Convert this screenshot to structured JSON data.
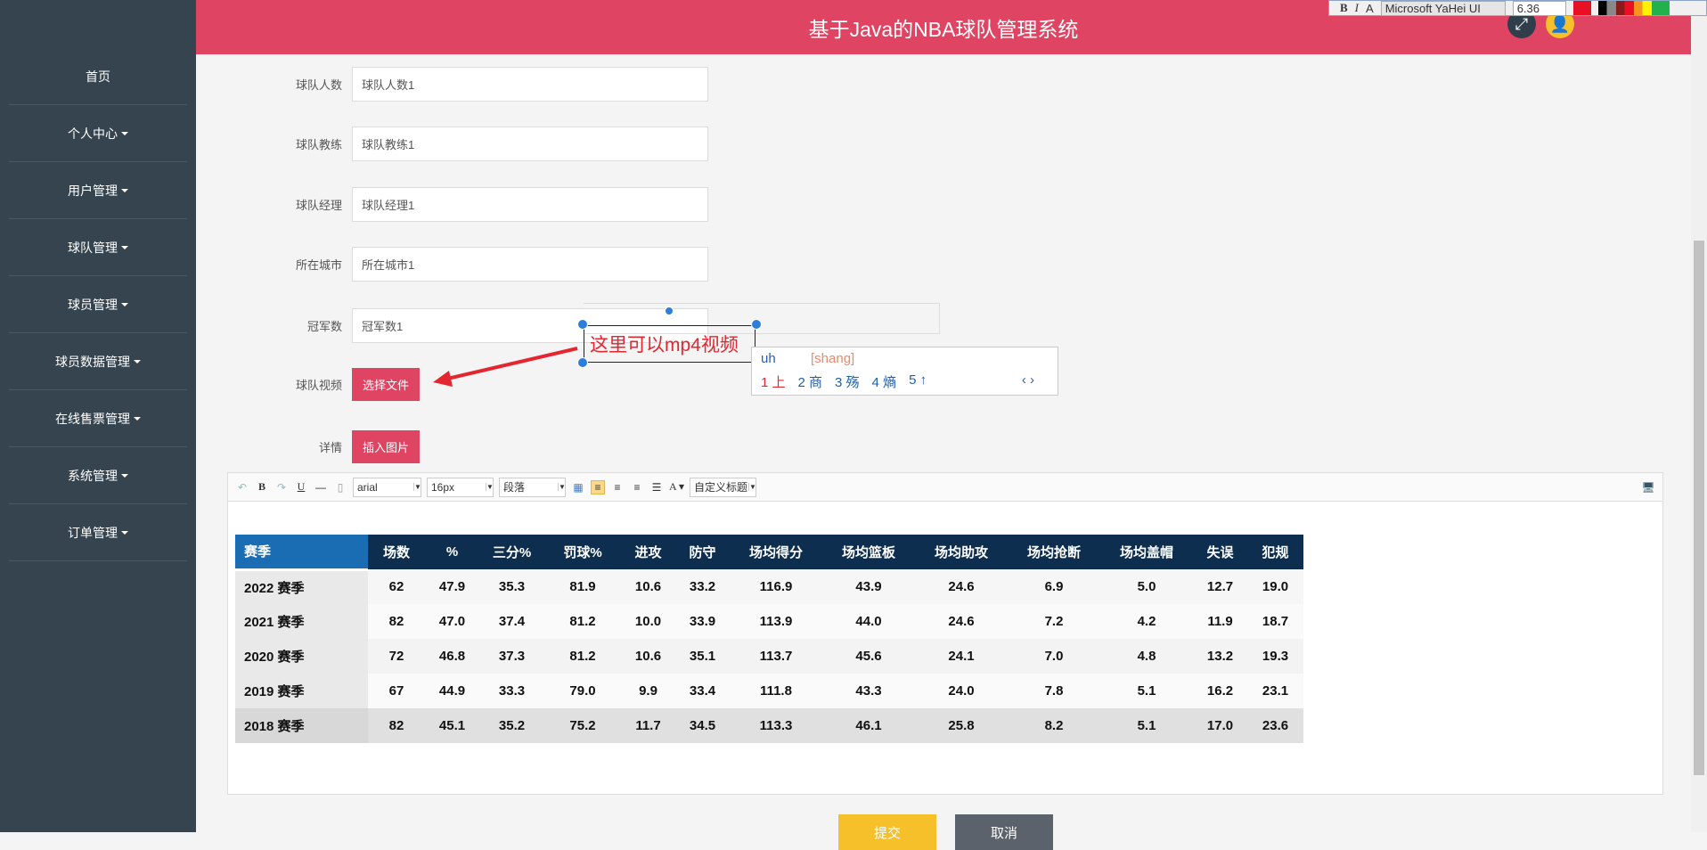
{
  "app": {
    "title": "基于Java的NBA球队管理系统"
  },
  "sidebar": {
    "items": [
      {
        "label": "首页"
      },
      {
        "label": "个人中心"
      },
      {
        "label": "用户管理"
      },
      {
        "label": "球队管理"
      },
      {
        "label": "球员管理"
      },
      {
        "label": "球员数据管理"
      },
      {
        "label": "在线售票管理"
      },
      {
        "label": "系统管理"
      },
      {
        "label": "订单管理"
      }
    ]
  },
  "form": {
    "team_size": {
      "label": "球队人数",
      "value": "球队人数1"
    },
    "coach": {
      "label": "球队教练",
      "value": "球队教练1"
    },
    "manager": {
      "label": "球队经理",
      "value": "球队经理1"
    },
    "city": {
      "label": "所在城市",
      "value": "所在城市1"
    },
    "titles": {
      "label": "冠军数",
      "value": "冠军数1"
    },
    "video": {
      "label": "球队视频",
      "button": "选择文件"
    },
    "detail": {
      "label": "详情",
      "button": "插入图片"
    },
    "submit": "提交",
    "cancel": "取消"
  },
  "editor": {
    "font": "arial",
    "size": "16px",
    "paragraph": "段落",
    "custom_heading": "自定义标题"
  },
  "table": {
    "headers": [
      "赛季",
      "场数",
      "%",
      "三分%",
      "罚球%",
      "进攻",
      "防守",
      "场均得分",
      "场均篮板",
      "场均助攻",
      "场均抢断",
      "场均盖帽",
      "失误",
      "犯规"
    ],
    "rows": [
      [
        "2022 赛季",
        "62",
        "47.9",
        "35.3",
        "81.9",
        "10.6",
        "33.2",
        "116.9",
        "43.9",
        "24.6",
        "6.9",
        "5.0",
        "12.7",
        "19.0"
      ],
      [
        "2021 赛季",
        "82",
        "47.0",
        "37.4",
        "81.2",
        "10.0",
        "33.9",
        "113.9",
        "44.0",
        "24.6",
        "7.2",
        "4.2",
        "11.9",
        "18.7"
      ],
      [
        "2020 赛季",
        "72",
        "46.8",
        "37.3",
        "81.2",
        "10.6",
        "35.1",
        "113.7",
        "45.6",
        "24.1",
        "7.0",
        "4.8",
        "13.2",
        "19.3"
      ],
      [
        "2019 赛季",
        "67",
        "44.9",
        "33.3",
        "79.0",
        "9.9",
        "33.4",
        "111.8",
        "43.3",
        "24.0",
        "7.8",
        "5.1",
        "16.2",
        "23.1"
      ],
      [
        "2018 赛季",
        "82",
        "45.1",
        "35.2",
        "75.2",
        "11.7",
        "34.5",
        "113.3",
        "46.1",
        "25.8",
        "8.2",
        "5.1",
        "17.0",
        "23.6"
      ]
    ]
  },
  "annotation": {
    "text": "这里可以mp4视频"
  },
  "ime": {
    "input": "uh",
    "pinyin": "[shang]",
    "candidates": [
      "1 上",
      "2 商",
      "3 殇",
      "4 熵",
      "5 ↑"
    ]
  },
  "format_toolbar": {
    "font": "Microsoft YaHei UI",
    "size": "6.36"
  },
  "colors": {
    "header": "#df4562",
    "sidebar": "#35444f",
    "table_header": "#0e2e4f"
  }
}
